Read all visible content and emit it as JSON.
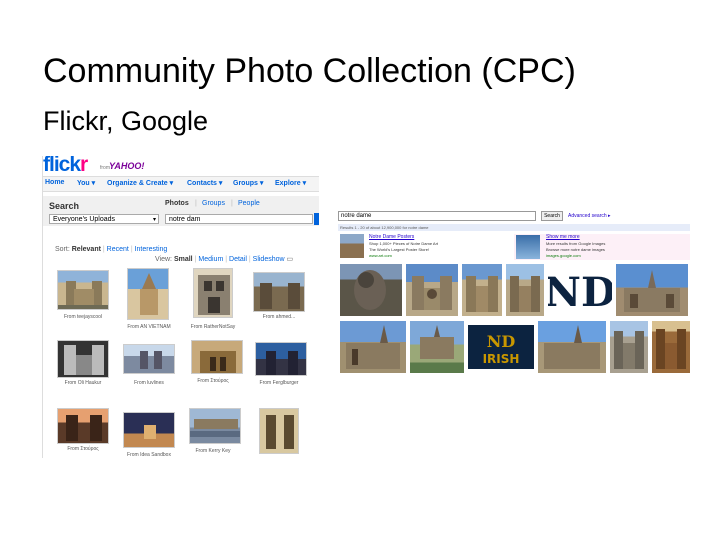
{
  "slide": {
    "title": "Community Photo Collection (CPC)",
    "subtitle": "Flickr, Google"
  },
  "flickr": {
    "logo_a": "flick",
    "logo_b": "r",
    "from": "from",
    "yahoo": "YAHOO!",
    "nav": [
      "Home",
      "You ▾",
      "Organize & Create ▾",
      "Contacts ▾",
      "Groups ▾",
      "Explore ▾"
    ],
    "search_title": "Search",
    "tabs": {
      "photos": "Photos",
      "sep": "|",
      "groups": "Groups",
      "people": "People"
    },
    "scope": "Everyone's Uploads",
    "scope_arrow": "▾",
    "query": "notre dam",
    "sort": {
      "label": "Sort:",
      "relevant": "Relevant",
      "sep": "|",
      "recent": "Recent",
      "interesting": "Interesting"
    },
    "view": {
      "label": "View:",
      "small": "Small",
      "sep": "|",
      "medium": "Medium",
      "detail": "Detail",
      "slideshow": "Slideshow"
    },
    "captions": [
      "From teejayscool",
      "From AN VIETNAM",
      "From RatherNotSay",
      "From ahmed...",
      "From Oli Haukur",
      "From luvlines",
      "From Στούρος",
      "From Ferglburger",
      "From Στούρος",
      "From Idea Sandbox",
      "From Kerry Key"
    ]
  },
  "google": {
    "query": "notre dame",
    "button": "Search",
    "advanced": "Advanced search ▸",
    "stats": "Results 1 - 20 of about 12,900,000 for notre dame",
    "ad1": {
      "title": "Notre Dame Posters",
      "line1": "Shop 1,000+ Pieces of Notre Dame Art",
      "line2": "The World's Largest Poster Store!",
      "line3": "www.art.com"
    },
    "ad2": {
      "title": "Show me more",
      "line1": "More results from Google Images",
      "line2": "Browse more notre dame images",
      "line3": "images.google.com"
    },
    "logo_text": "ND",
    "irish_text": "IRISH"
  }
}
